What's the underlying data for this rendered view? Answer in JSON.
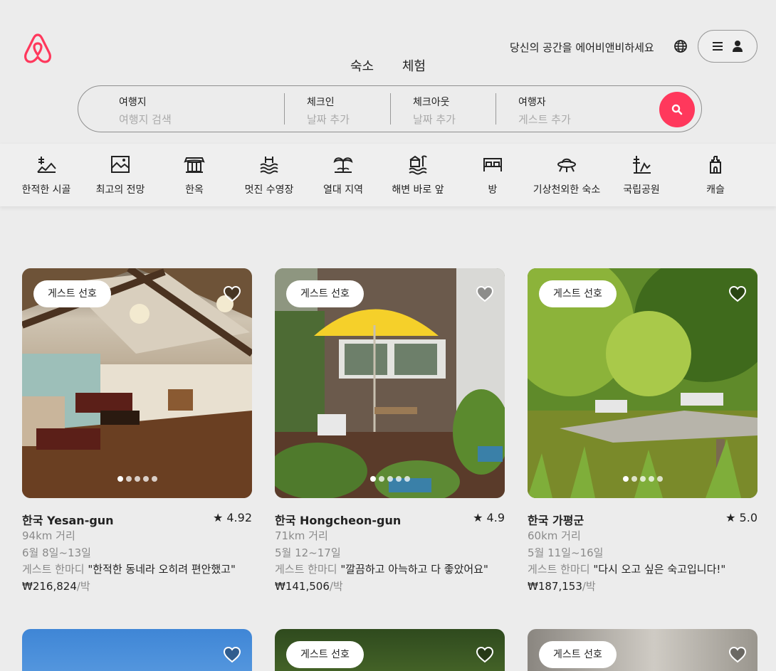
{
  "header": {
    "nav": [
      "숙소",
      "체험"
    ],
    "host_link": "당신의 공간을 에어비앤비하세요"
  },
  "search": {
    "where_label": "여행지",
    "where_placeholder": "여행지 검색",
    "checkin_label": "체크인",
    "checkin_placeholder": "날짜 추가",
    "checkout_label": "체크아웃",
    "checkout_placeholder": "날짜 추가",
    "guests_label": "여행자",
    "guests_placeholder": "게스트 추가"
  },
  "categories": [
    {
      "label": "한적한 시골",
      "icon": "countryside-icon"
    },
    {
      "label": "최고의 전망",
      "icon": "view-icon"
    },
    {
      "label": "한옥",
      "icon": "hanok-icon"
    },
    {
      "label": "멋진 수영장",
      "icon": "pool-icon"
    },
    {
      "label": "열대 지역",
      "icon": "tropical-icon"
    },
    {
      "label": "해변 바로 앞",
      "icon": "beachfront-icon"
    },
    {
      "label": "방",
      "icon": "room-icon"
    },
    {
      "label": "기상천외한 숙소",
      "icon": "ufo-icon"
    },
    {
      "label": "국립공원",
      "icon": "national-park-icon"
    },
    {
      "label": "캐슬",
      "icon": "castle-icon"
    }
  ],
  "listings": [
    {
      "badge": "게스트 선호",
      "title": "한국 Yesan-gun",
      "rating": "★ 4.92",
      "distance": "94km 거리",
      "dates": "6월 8일~13일",
      "review_prefix": "게스트 한마디",
      "review": "\"한적한 동네라 오히려 편안했고\"",
      "price": "₩216,824",
      "per": "/박"
    },
    {
      "badge": "게스트 선호",
      "title": "한국 Hongcheon-gun",
      "rating": "★ 4.9",
      "distance": "71km 거리",
      "dates": "5월 12~17일",
      "review_prefix": "게스트 한마디",
      "review": "\"깔끔하고 아늑하고 다 좋았어요\"",
      "price": "₩141,506",
      "per": "/박"
    },
    {
      "badge": "게스트 선호",
      "title": "한국 가평군",
      "rating": "★ 5.0",
      "distance": "60km 거리",
      "dates": "5월 11일~16일",
      "review_prefix": "게스트 한마디",
      "review": "\"다시 오고 싶은 숙고입니다!\"",
      "price": "₩187,153",
      "per": "/박"
    }
  ],
  "next_row_badges": [
    "게스트 선호",
    "게스트 선호"
  ],
  "colors": {
    "brand": "#ff385c"
  }
}
